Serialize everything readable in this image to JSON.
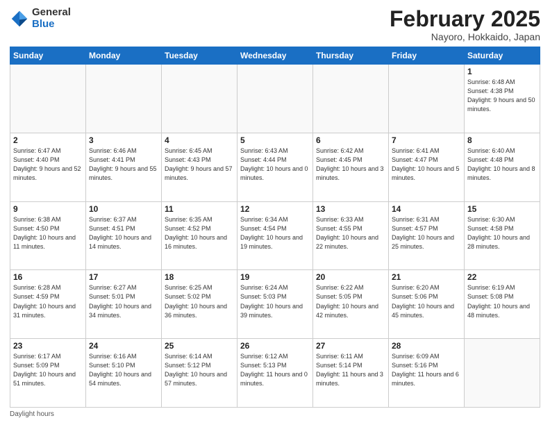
{
  "header": {
    "logo_general": "General",
    "logo_blue": "Blue",
    "title": "February 2025",
    "subtitle": "Nayoro, Hokkaido, Japan"
  },
  "days_of_week": [
    "Sunday",
    "Monday",
    "Tuesday",
    "Wednesday",
    "Thursday",
    "Friday",
    "Saturday"
  ],
  "weeks": [
    [
      {
        "day": "",
        "info": ""
      },
      {
        "day": "",
        "info": ""
      },
      {
        "day": "",
        "info": ""
      },
      {
        "day": "",
        "info": ""
      },
      {
        "day": "",
        "info": ""
      },
      {
        "day": "",
        "info": ""
      },
      {
        "day": "1",
        "info": "Sunrise: 6:48 AM\nSunset: 4:38 PM\nDaylight: 9 hours and 50 minutes."
      }
    ],
    [
      {
        "day": "2",
        "info": "Sunrise: 6:47 AM\nSunset: 4:40 PM\nDaylight: 9 hours and 52 minutes."
      },
      {
        "day": "3",
        "info": "Sunrise: 6:46 AM\nSunset: 4:41 PM\nDaylight: 9 hours and 55 minutes."
      },
      {
        "day": "4",
        "info": "Sunrise: 6:45 AM\nSunset: 4:43 PM\nDaylight: 9 hours and 57 minutes."
      },
      {
        "day": "5",
        "info": "Sunrise: 6:43 AM\nSunset: 4:44 PM\nDaylight: 10 hours and 0 minutes."
      },
      {
        "day": "6",
        "info": "Sunrise: 6:42 AM\nSunset: 4:45 PM\nDaylight: 10 hours and 3 minutes."
      },
      {
        "day": "7",
        "info": "Sunrise: 6:41 AM\nSunset: 4:47 PM\nDaylight: 10 hours and 5 minutes."
      },
      {
        "day": "8",
        "info": "Sunrise: 6:40 AM\nSunset: 4:48 PM\nDaylight: 10 hours and 8 minutes."
      }
    ],
    [
      {
        "day": "9",
        "info": "Sunrise: 6:38 AM\nSunset: 4:50 PM\nDaylight: 10 hours and 11 minutes."
      },
      {
        "day": "10",
        "info": "Sunrise: 6:37 AM\nSunset: 4:51 PM\nDaylight: 10 hours and 14 minutes."
      },
      {
        "day": "11",
        "info": "Sunrise: 6:35 AM\nSunset: 4:52 PM\nDaylight: 10 hours and 16 minutes."
      },
      {
        "day": "12",
        "info": "Sunrise: 6:34 AM\nSunset: 4:54 PM\nDaylight: 10 hours and 19 minutes."
      },
      {
        "day": "13",
        "info": "Sunrise: 6:33 AM\nSunset: 4:55 PM\nDaylight: 10 hours and 22 minutes."
      },
      {
        "day": "14",
        "info": "Sunrise: 6:31 AM\nSunset: 4:57 PM\nDaylight: 10 hours and 25 minutes."
      },
      {
        "day": "15",
        "info": "Sunrise: 6:30 AM\nSunset: 4:58 PM\nDaylight: 10 hours and 28 minutes."
      }
    ],
    [
      {
        "day": "16",
        "info": "Sunrise: 6:28 AM\nSunset: 4:59 PM\nDaylight: 10 hours and 31 minutes."
      },
      {
        "day": "17",
        "info": "Sunrise: 6:27 AM\nSunset: 5:01 PM\nDaylight: 10 hours and 34 minutes."
      },
      {
        "day": "18",
        "info": "Sunrise: 6:25 AM\nSunset: 5:02 PM\nDaylight: 10 hours and 36 minutes."
      },
      {
        "day": "19",
        "info": "Sunrise: 6:24 AM\nSunset: 5:03 PM\nDaylight: 10 hours and 39 minutes."
      },
      {
        "day": "20",
        "info": "Sunrise: 6:22 AM\nSunset: 5:05 PM\nDaylight: 10 hours and 42 minutes."
      },
      {
        "day": "21",
        "info": "Sunrise: 6:20 AM\nSunset: 5:06 PM\nDaylight: 10 hours and 45 minutes."
      },
      {
        "day": "22",
        "info": "Sunrise: 6:19 AM\nSunset: 5:08 PM\nDaylight: 10 hours and 48 minutes."
      }
    ],
    [
      {
        "day": "23",
        "info": "Sunrise: 6:17 AM\nSunset: 5:09 PM\nDaylight: 10 hours and 51 minutes."
      },
      {
        "day": "24",
        "info": "Sunrise: 6:16 AM\nSunset: 5:10 PM\nDaylight: 10 hours and 54 minutes."
      },
      {
        "day": "25",
        "info": "Sunrise: 6:14 AM\nSunset: 5:12 PM\nDaylight: 10 hours and 57 minutes."
      },
      {
        "day": "26",
        "info": "Sunrise: 6:12 AM\nSunset: 5:13 PM\nDaylight: 11 hours and 0 minutes."
      },
      {
        "day": "27",
        "info": "Sunrise: 6:11 AM\nSunset: 5:14 PM\nDaylight: 11 hours and 3 minutes."
      },
      {
        "day": "28",
        "info": "Sunrise: 6:09 AM\nSunset: 5:16 PM\nDaylight: 11 hours and 6 minutes."
      },
      {
        "day": "",
        "info": ""
      }
    ]
  ],
  "footer": {
    "daylight_label": "Daylight hours"
  }
}
